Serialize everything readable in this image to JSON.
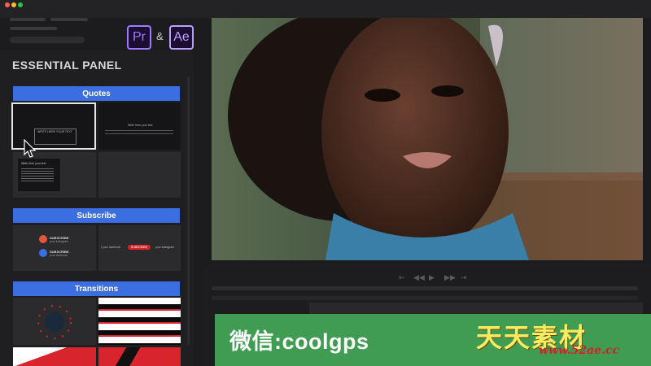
{
  "window": {
    "controls": [
      {
        "name": "close",
        "color": "#ff5f57"
      },
      {
        "name": "minimize",
        "color": "#febc2e"
      },
      {
        "name": "maximize",
        "color": "#28c840"
      }
    ]
  },
  "apps": {
    "premiere": {
      "label": "Pr",
      "color": "#9b7bff"
    },
    "ampersand": "&",
    "after_effects": {
      "label": "Ae",
      "color": "#b9a2ff"
    }
  },
  "panel": {
    "title": "ESSENTIAL PANEL",
    "sections": {
      "quotes": {
        "label": "Quotes",
        "tiles": [
          {
            "text": "WRITE HERE YOUR TEXT",
            "selected": true
          },
          {
            "text": "Write here your text"
          },
          {
            "text": "Write here your text"
          },
          {
            "text": ""
          }
        ]
      },
      "subscribe": {
        "label": "Subscribe",
        "items": [
          {
            "line1": "SUBSCRIBE",
            "line2": "your instagram"
          },
          {
            "line1": "SUBSCRIBE",
            "line2": "your facebook"
          }
        ],
        "chips": [
          "f your facebook",
          "SUBSCRIBE",
          "your instagram"
        ]
      },
      "transitions": {
        "label": "Transitions"
      }
    }
  },
  "timeline": {
    "controls": [
      "⇤",
      "◀◀",
      "▶",
      "▶▶",
      "⇥"
    ]
  },
  "overlay": {
    "wechat": "微信:coolgps",
    "brand_cn": "天天素材",
    "brand_url": "www.52ae.cc"
  },
  "accent": "#3b6ee0"
}
